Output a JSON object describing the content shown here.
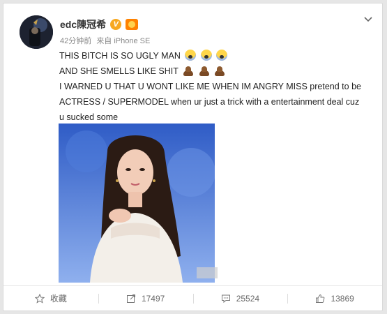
{
  "post": {
    "username": "edc陳冠希",
    "verified_icon": "verified-v-icon",
    "vip_icon": "vip-medal-icon",
    "timestamp": "42分钟前",
    "source": "来自 iPhone SE",
    "lines": [
      "THIS BITCH IS SO UGLY MAN",
      "AND SHE SMELLS LIKE SHIT",
      "I WARNED U THAT U WONT LIKE ME WHEN IM ANGRY MISS pretend to be ACTRESS / SUPERMODEL when ur just a trick with a entertainment deal cuz u sucked some"
    ],
    "line1_emoji": "fear-face-emoji",
    "line2_emoji": "poop-emoji"
  },
  "actions": {
    "favorite_label": "收藏",
    "repost_count": "17497",
    "comment_count": "25524",
    "like_count": "13869"
  },
  "colors": {
    "accent": "#f7a820",
    "text": "#333333",
    "meta": "#888888"
  }
}
